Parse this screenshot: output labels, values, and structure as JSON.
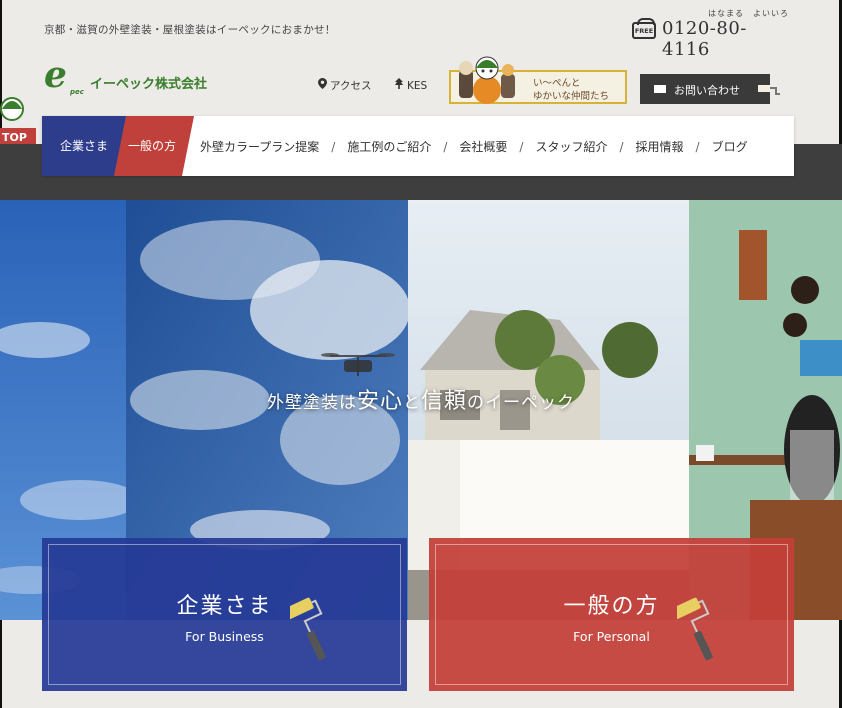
{
  "header": {
    "tagline": "京都・滋賀の外壁塗装・屋根塗装はイーペックにおまかせ！",
    "phone_kana": "はなまる　よいいろ",
    "free_label": "FREE",
    "phone_number": "0120-80-4116",
    "logo_mark": "e",
    "logo_sub": "pec",
    "company_name": "イーペック株式会社",
    "access_label": "アクセス",
    "kes_label": "KES",
    "banner_line1": "い～ぺんと",
    "banner_line2": "ゆかいな仲間たち",
    "contact_label": "お問い合わせ",
    "top_badge": "TOP"
  },
  "nav": {
    "corporate": "企業さま",
    "personal": "一般の方",
    "items": [
      "外壁カラープラン提案",
      "施工例のご紹介",
      "会社概要",
      "スタッフ紹介",
      "採用情報",
      "ブログ"
    ],
    "separator": "/"
  },
  "hero": {
    "catch_part1": "外壁塗装は",
    "catch_part2": "安心",
    "catch_part3": "と",
    "catch_part4": "信頼",
    "catch_part5": "のイーペック"
  },
  "cards": {
    "business_ja": "企業さま",
    "business_en": "For Business",
    "personal_ja": "一般の方",
    "personal_en": "For Personal"
  },
  "colors": {
    "brand_green": "#3a7d2c",
    "corporate_blue": "#2d3d8c",
    "personal_red": "#c0413b",
    "nav_band": "#3e3e3e"
  }
}
